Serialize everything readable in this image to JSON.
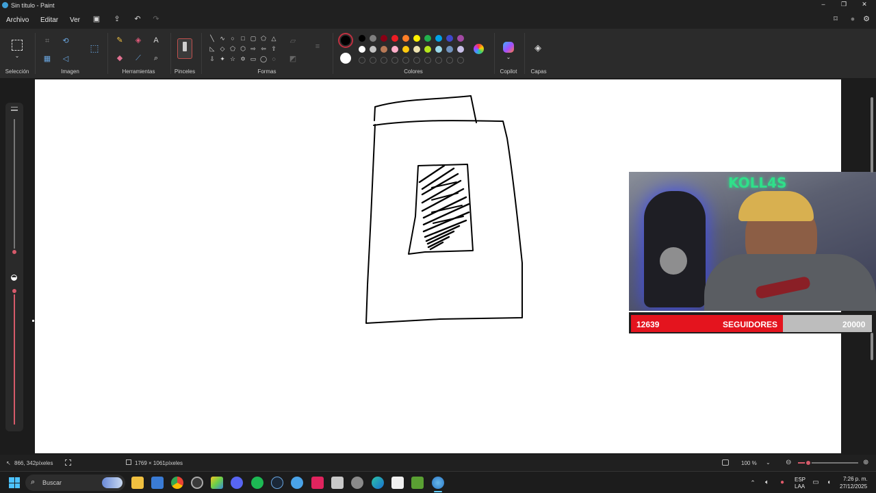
{
  "window": {
    "title": "Sin título - Paint"
  },
  "menu": {
    "file": "Archivo",
    "edit": "Editar",
    "view": "Ver"
  },
  "ribbon": {
    "groups": {
      "selection": "Selección",
      "image": "Imagen",
      "tools": "Herramientas",
      "brushes": "Pinceles",
      "shapes": "Formas",
      "colors": "Colores",
      "copilot": "Copilot",
      "layers": "Capas"
    },
    "palette_row1": [
      "#000000",
      "#7f7f7f",
      "#880015",
      "#ed1c24",
      "#ff7f27",
      "#fff200",
      "#22b14c",
      "#00a2e8",
      "#3f48cc",
      "#a349a4"
    ],
    "palette_row2": [
      "#ffffff",
      "#c3c3c3",
      "#b97a57",
      "#ffaec9",
      "#ffc90e",
      "#efe4b0",
      "#b5e61d",
      "#99d9ea",
      "#7092be",
      "#c8bfe7"
    ],
    "primary_color": "#000000",
    "secondary_color": "#ffffff"
  },
  "overlay": {
    "followers_current": "12639",
    "followers_label": "SEGUIDORES",
    "followers_goal": "20000",
    "followers_progress": 0.632,
    "webcam_sign": "KOLL4S"
  },
  "status": {
    "cursor_position": "866, 342píxeles",
    "canvas_size": "1769 × 1061píxeles",
    "zoom": "100 %"
  },
  "taskbar": {
    "search_placeholder": "Buscar",
    "lang_line1": "ESP",
    "lang_line2": "LAA",
    "time": "7:26 p. m.",
    "date": "27/12/2025"
  }
}
